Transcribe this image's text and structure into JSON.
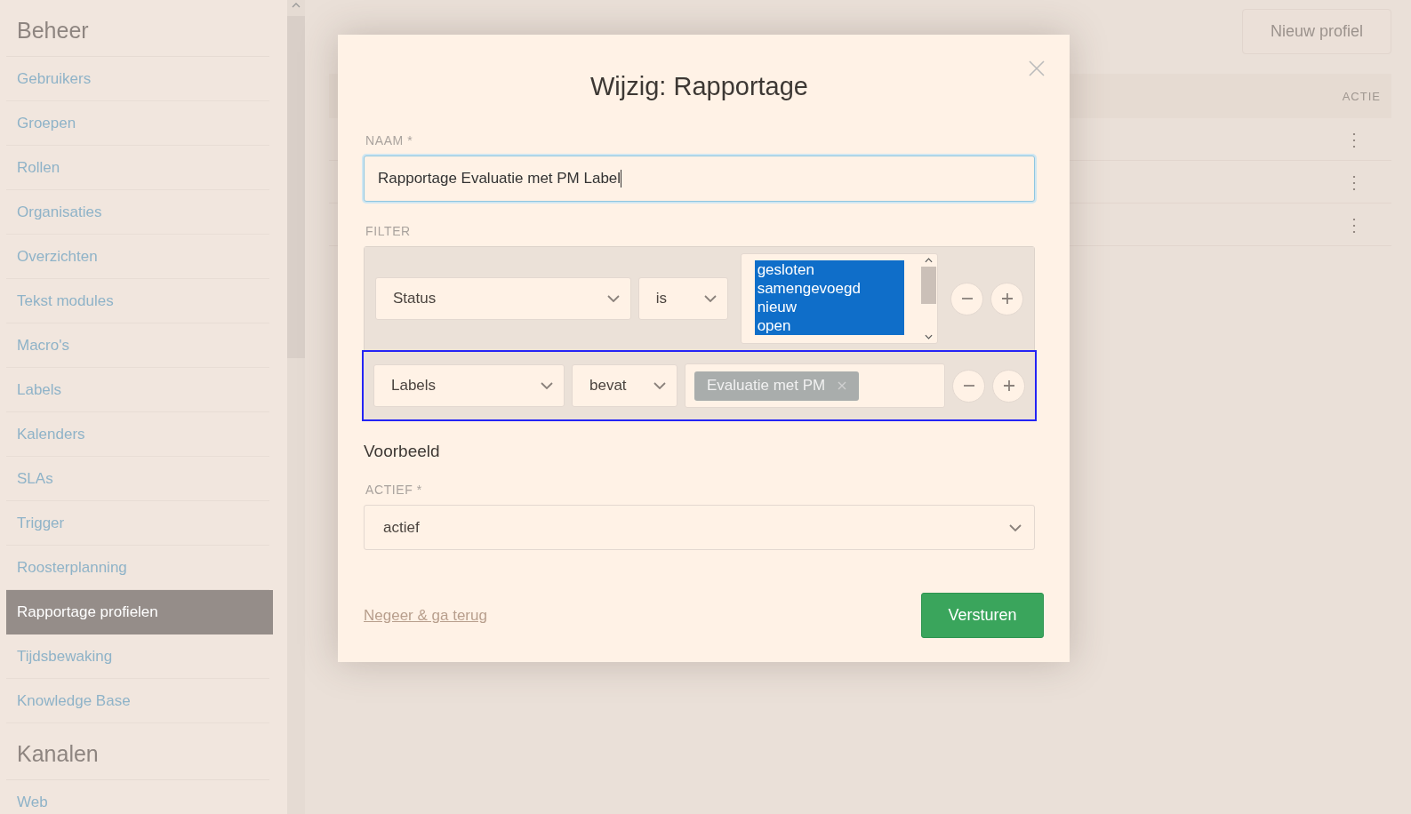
{
  "sidebar": {
    "sections": [
      {
        "title": "Beheer",
        "items": [
          {
            "label": "Gebruikers",
            "selected": false
          },
          {
            "label": "Groepen",
            "selected": false
          },
          {
            "label": "Rollen",
            "selected": false
          },
          {
            "label": "Organisaties",
            "selected": false
          },
          {
            "label": "Overzichten",
            "selected": false
          },
          {
            "label": "Tekst modules",
            "selected": false
          },
          {
            "label": "Macro's",
            "selected": false
          },
          {
            "label": "Labels",
            "selected": false
          },
          {
            "label": "Kalenders",
            "selected": false
          },
          {
            "label": "SLAs",
            "selected": false
          },
          {
            "label": "Trigger",
            "selected": false
          },
          {
            "label": "Roosterplanning",
            "selected": false
          },
          {
            "label": "Rapportage profielen",
            "selected": true
          },
          {
            "label": "Tijdsbewaking",
            "selected": false
          },
          {
            "label": "Knowledge Base",
            "selected": false
          }
        ]
      },
      {
        "title": "Kanalen",
        "items": [
          {
            "label": "Web",
            "selected": false
          }
        ]
      }
    ]
  },
  "page": {
    "new_button": "Nieuw profiel",
    "table": {
      "columns": [
        "ACTIE"
      ],
      "rows": [
        {
          "action": "⋮"
        },
        {
          "action": "⋮"
        },
        {
          "action": "⋮"
        }
      ]
    }
  },
  "modal": {
    "title": "Wijzig: Rapportage",
    "name_label": "NAAM *",
    "name_value": "Rapportage Evaluatie met PM Label",
    "filter_label": "FILTER",
    "filters": [
      {
        "kind": "multiselect",
        "focused": false,
        "attribute": "Status",
        "operator": "is",
        "options": [
          {
            "label": "gesloten",
            "selected": true
          },
          {
            "label": "samengevoegd",
            "selected": true
          },
          {
            "label": "nieuw",
            "selected": true
          },
          {
            "label": "open",
            "selected": true
          }
        ]
      },
      {
        "kind": "tags",
        "focused": true,
        "attribute": "Labels",
        "operator": "bevat",
        "tags": [
          "Evaluatie met PM"
        ]
      }
    ],
    "preview_heading": "Voorbeeld",
    "active_label": "ACTIEF *",
    "active_value": "actief",
    "cancel": "Negeer & ga terug",
    "submit": "Versturen"
  }
}
